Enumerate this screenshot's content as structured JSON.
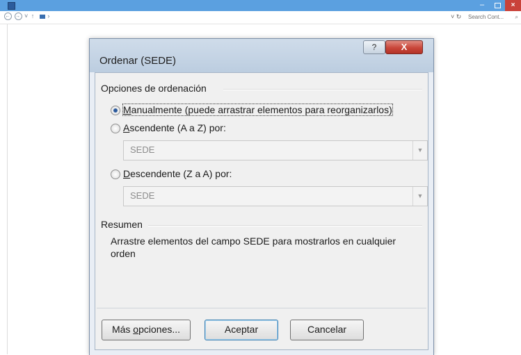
{
  "explorer": {
    "min_glyph": "–",
    "close_glyph": "×",
    "nav_glyphs": "← → ˅ ↑",
    "refresh_glyph": "˅ ↻",
    "search_placeholder": "Search Cont...",
    "search_icon": "⌕"
  },
  "dialog": {
    "title": "Ordenar (SEDE)",
    "help_glyph": "?",
    "close_glyph": "X",
    "sort_group_label": "Opciones de ordenación",
    "options": [
      {
        "accel": "M",
        "rest": "anualmente (puede arrastrar elementos para reorganizarlos)",
        "checked": true
      },
      {
        "accel": "A",
        "rest": "scendente (A a Z) por:",
        "checked": false
      },
      {
        "accel": "D",
        "rest": "escendente (Z a A) por:",
        "checked": false
      }
    ],
    "ascending_field": "SEDE",
    "descending_field": "SEDE",
    "summary_group_label": "Resumen",
    "summary_text": "Arrastre elementos del campo SEDE para mostrarlos en cualquier orden",
    "more_options_pre": "Más ",
    "more_options_accel": "o",
    "more_options_post": "pciones...",
    "ok_label": "Aceptar",
    "cancel_label": "Cancelar"
  }
}
